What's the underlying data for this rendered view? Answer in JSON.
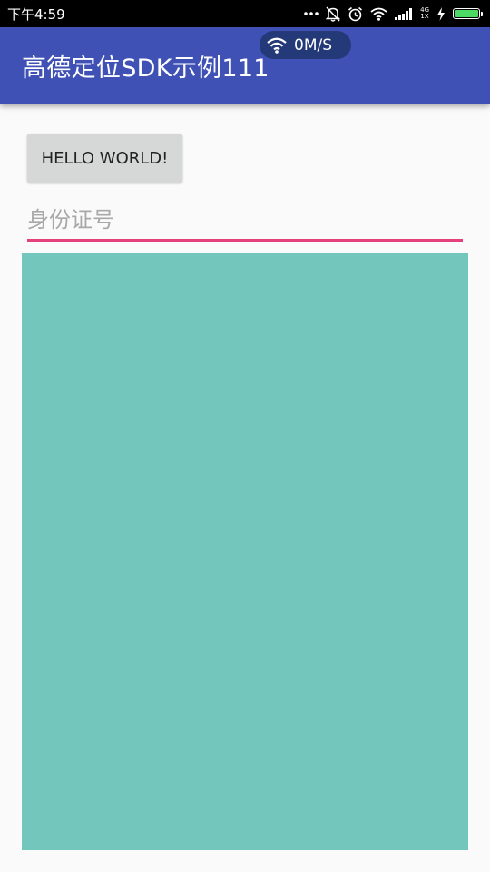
{
  "status_bar": {
    "time": "下午4:59",
    "icons": [
      "more-dots-icon",
      "notification-muted-icon",
      "alarm-icon",
      "wifi-icon",
      "signal-icon",
      "network-type-icon",
      "charging-icon",
      "battery-icon"
    ],
    "network_type": [
      "4G",
      "1X"
    ],
    "battery_level": 1.0,
    "battery_color": "#4cd964"
  },
  "app_bar": {
    "title": "高德定位SDK示例111",
    "color": "#3f51b5"
  },
  "speed_overlay": {
    "icon": "wifi-icon",
    "speed": "0M/S"
  },
  "main": {
    "hello_button_label": "HELLO WORLD!",
    "id_input": {
      "placeholder": "身份证号",
      "value": "",
      "underline_color": "#e5407b"
    },
    "panel": {
      "color": "#72c6bc"
    }
  }
}
